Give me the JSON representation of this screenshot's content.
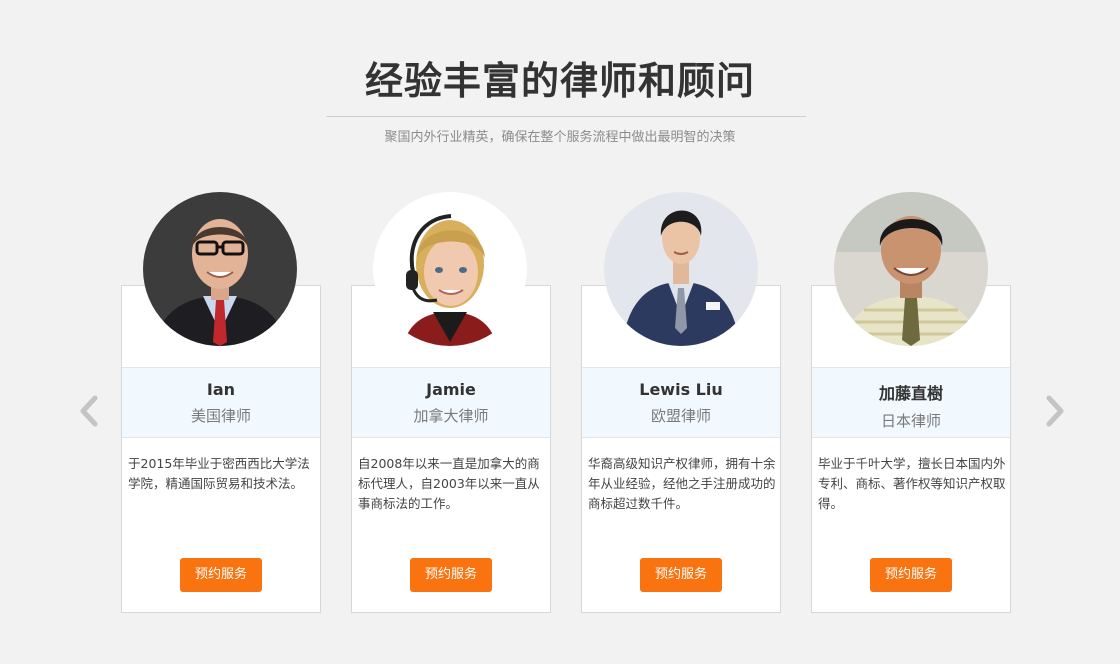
{
  "header": {
    "title": "经验丰富的律师和顾问",
    "subtitle": "聚国内外行业精英，确保在整个服务流程中做出最明智的决策"
  },
  "lawyers": [
    {
      "name": "Ian",
      "role": "美国律师",
      "description": "于2015年毕业于密西西比大学法学院，精通国际贸易和技术法。",
      "button": "预约服务"
    },
    {
      "name": "Jamie",
      "role": "加拿大律师",
      "description": "自2008年以来一直是加拿大的商标代理人，自2003年以来一直从事商标法的工作。",
      "button": "预约服务"
    },
    {
      "name": "Lewis Liu",
      "role": "欧盟律师",
      "description": "华裔高级知识产权律师，拥有十余年从业经验，经他之手注册成功的商标超过数千件。",
      "button": "预约服务"
    },
    {
      "name": "加藤直樹",
      "role": "日本律师",
      "description": "毕业于千叶大学，擅长日本国内外专利、商标、著作权等知识产权取得。",
      "button": "预约服务"
    }
  ],
  "navigation": {
    "prev_icon": "chevron-left-icon",
    "next_icon": "chevron-right-icon"
  },
  "colors": {
    "accent": "#f97411",
    "name_band": "#f2f9fe",
    "background": "#f2f2f2"
  }
}
